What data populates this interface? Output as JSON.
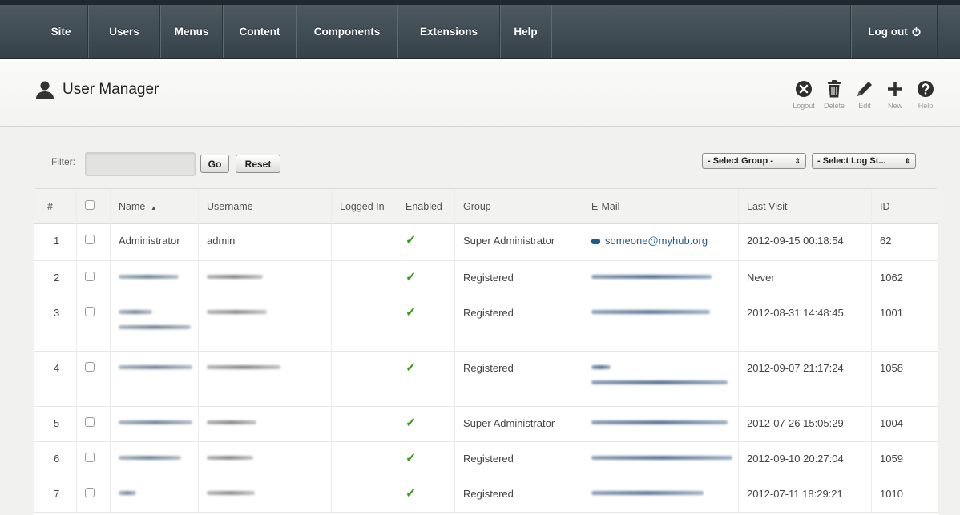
{
  "nav": {
    "items": [
      "Site",
      "Users",
      "Menus",
      "Content",
      "Components",
      "Extensions",
      "Help"
    ],
    "logout": "Log out"
  },
  "header": {
    "title": "User Manager"
  },
  "toolbar": {
    "logout": "Logout",
    "delete": "Delete",
    "edit": "Edit",
    "new": "New",
    "help": "Help"
  },
  "filter": {
    "label": "Filter:",
    "input_value": "",
    "go": "Go",
    "reset": "Reset",
    "select_group": "- Select Group -",
    "select_log": "- Select Log St..."
  },
  "table": {
    "headers": [
      "#",
      "",
      "Name",
      "Username",
      "Logged In",
      "Enabled",
      "Group",
      "E-Mail",
      "Last Visit",
      "ID"
    ],
    "rows": [
      {
        "num": "1",
        "name": "Administrator",
        "username": "admin",
        "group": "Super Administrator",
        "email": "someone@myhub.org",
        "last_visit": "2012-09-15 00:18:54",
        "id": "62",
        "enabled": true
      },
      {
        "num": "2",
        "name": "",
        "username": "",
        "group": "Registered",
        "email": "",
        "last_visit": "Never",
        "id": "1062",
        "enabled": true
      },
      {
        "num": "3",
        "name": "",
        "username": "",
        "group": "Registered",
        "email": "",
        "last_visit": "2012-08-31 14:48:45",
        "id": "1001",
        "enabled": true
      },
      {
        "num": "4",
        "name": "",
        "username": "",
        "group": "Registered",
        "email": "",
        "last_visit": "2012-09-07 21:17:24",
        "id": "1058",
        "enabled": true
      },
      {
        "num": "5",
        "name": "",
        "username": "",
        "group": "Super Administrator",
        "email": "",
        "last_visit": "2012-07-26 15:05:29",
        "id": "1004",
        "enabled": true
      },
      {
        "num": "6",
        "name": "",
        "username": "",
        "group": "Registered",
        "email": "",
        "last_visit": "2012-09-10 20:27:04",
        "id": "1059",
        "enabled": true
      },
      {
        "num": "7",
        "name": "",
        "username": "",
        "group": "Registered",
        "email": "",
        "last_visit": "2012-07-11 18:29:21",
        "id": "1010",
        "enabled": true
      }
    ]
  },
  "icons": {
    "checkmark": "checkmark-icon",
    "user": "user-icon",
    "mail": "mail-icon",
    "sort": "sort-asc-icon"
  },
  "colors": {
    "navbar": "#3f4a52",
    "link": "#1e5a8a",
    "enabled": "#3d9a1c"
  }
}
